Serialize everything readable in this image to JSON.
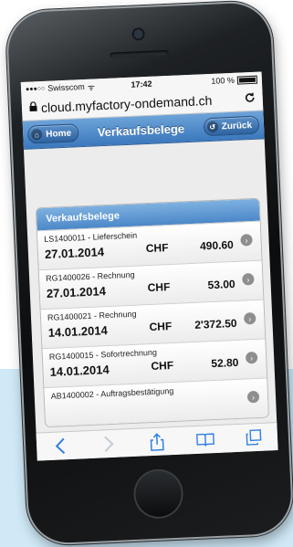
{
  "status_bar": {
    "signal": "●●●○○",
    "carrier": "Swisscom",
    "wifi": "ᯤ",
    "time": "17:42",
    "battery": "100 %"
  },
  "browser": {
    "lock_icon": "lock-icon",
    "url": "cloud.myfactory-ondemand.ch",
    "reload_glyph": "C"
  },
  "header": {
    "home_label": "Home",
    "title": "Verkaufsbelege",
    "back_label": "Zurück"
  },
  "list": {
    "heading": "Verkaufsbelege",
    "rows": [
      {
        "title": "LS1400011 - Lieferschein",
        "date": "27.01.2014",
        "currency": "CHF",
        "amount": "490.60"
      },
      {
        "title": "RG1400026 - Rechnung",
        "date": "27.01.2014",
        "currency": "CHF",
        "amount": "53.00"
      },
      {
        "title": "RG1400021 - Rechnung",
        "date": "14.01.2014",
        "currency": "CHF",
        "amount": "2'372.50"
      },
      {
        "title": "RG1400015 - Sofortrechnung",
        "date": "14.01.2014",
        "currency": "CHF",
        "amount": "52.80"
      },
      {
        "title": "AB1400002 - Auftragsbestätigung",
        "date": "",
        "currency": "",
        "amount": ""
      }
    ]
  },
  "colors": {
    "header_blue": "#3b78bd",
    "toolbar_icon_blue": "#2f7fe0",
    "background_panel": "#cfe9f7"
  }
}
